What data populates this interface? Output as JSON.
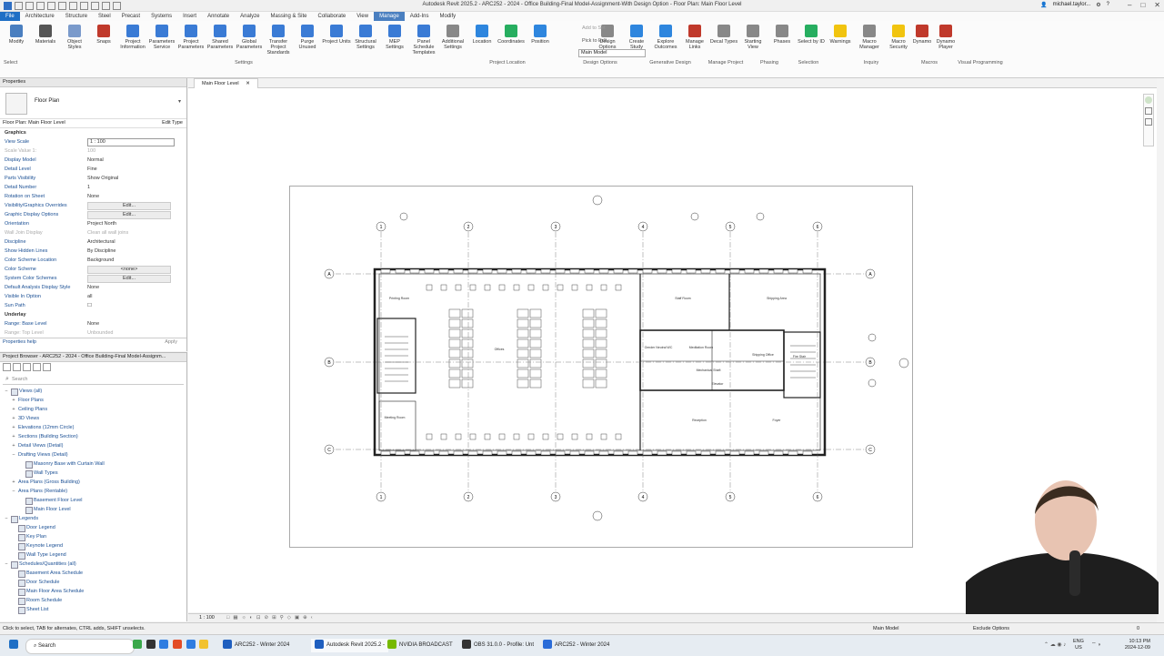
{
  "titlebar": {
    "title": "Autodesk Revit 2025.2 - ARC252 - 2024 - Office Building-Final Model-Assignment-With Design Option - Floor Plan: Main Floor Level",
    "user": "michael.taylor..."
  },
  "ribbon_tabs": [
    "File",
    "Architecture",
    "Structure",
    "Steel",
    "Precast",
    "Systems",
    "Insert",
    "Annotate",
    "Analyze",
    "Massing & Site",
    "Collaborate",
    "View",
    "Manage",
    "Add-Ins",
    "Modify"
  ],
  "ribbon_active_tab": "Manage",
  "ribbon": {
    "buttons": [
      {
        "label": "Modify",
        "color": "#4a7fc0"
      },
      {
        "label": "Materials",
        "color": "#555555"
      },
      {
        "label": "Object Styles",
        "color": "#7a9acb"
      },
      {
        "label": "Snaps",
        "color": "#c0392b"
      },
      {
        "label": "Project Information",
        "color": "#3a7bd5"
      },
      {
        "label": "Parameters Service",
        "color": "#3a7bd5"
      },
      {
        "label": "Project Parameters",
        "color": "#3a7bd5"
      },
      {
        "label": "Shared Parameters",
        "color": "#3a7bd5"
      },
      {
        "label": "Global Parameters",
        "color": "#3a7bd5"
      },
      {
        "label": "Transfer Project Standards",
        "color": "#3a7bd5"
      },
      {
        "label": "Purge Unused",
        "color": "#3a7bd5"
      },
      {
        "label": "Project Units",
        "color": "#3a7bd5"
      },
      {
        "label": "Structural Settings",
        "color": "#3a7bd5"
      },
      {
        "label": "MEP Settings",
        "color": "#3a7bd5"
      },
      {
        "label": "Panel Schedule Templates",
        "color": "#3a7bd5"
      },
      {
        "label": "Additional Settings",
        "color": "#888888"
      },
      {
        "label": "Location",
        "color": "#2e86de"
      },
      {
        "label": "Coordinates",
        "color": "#27ae60"
      },
      {
        "label": "Position",
        "color": "#2e86de"
      },
      {
        "label": "Design Options",
        "color": "#888888"
      },
      {
        "label": "Create Study",
        "color": "#2e86de"
      },
      {
        "label": "Explore Outcomes",
        "color": "#2e86de"
      },
      {
        "label": "Manage Links",
        "color": "#c0392b"
      },
      {
        "label": "Decal Types",
        "color": "#888888"
      },
      {
        "label": "Starting View",
        "color": "#888888"
      },
      {
        "label": "Phases",
        "color": "#888888"
      },
      {
        "label": "Select by ID",
        "color": "#27ae60"
      },
      {
        "label": "Warnings",
        "color": "#f1c40f"
      },
      {
        "label": "Macro Manager",
        "color": "#888888"
      },
      {
        "label": "Macro Security",
        "color": "#f1c40f"
      },
      {
        "label": "Dynamo",
        "color": "#c0392b"
      },
      {
        "label": "Dynamo Player",
        "color": "#c0392b"
      }
    ],
    "design_option_field": "Main Model",
    "add_to_set": "Add to Set",
    "pick_to_edit": "Pick to Edit",
    "groups": [
      "Settings",
      "Project Location",
      "Design Options",
      "Generative Design",
      "Manage Project",
      "Phasing",
      "Selection",
      "Inquiry",
      "Macros",
      "Visual Programming"
    ],
    "select_label": "Select"
  },
  "properties": {
    "header": "Properties",
    "type_name": "Floor Plan",
    "selector": "Floor Plan: Main Floor Level",
    "edit_type": "Edit Type",
    "rows": [
      {
        "k": "Graphics",
        "v": "",
        "cat": true
      },
      {
        "k": "View Scale",
        "v": "1 : 100",
        "input": true
      },
      {
        "k": "Scale Value    1:",
        "v": "100",
        "disabled": true
      },
      {
        "k": "Display Model",
        "v": "Normal"
      },
      {
        "k": "Detail Level",
        "v": "Fine"
      },
      {
        "k": "Parts Visibility",
        "v": "Show Original"
      },
      {
        "k": "Detail Number",
        "v": "1"
      },
      {
        "k": "Rotation on Sheet",
        "v": "None"
      },
      {
        "k": "Visibility/Graphics Overrides",
        "v": "Edit...",
        "btn": true
      },
      {
        "k": "Graphic Display Options",
        "v": "Edit...",
        "btn": true
      },
      {
        "k": "Orientation",
        "v": "Project North"
      },
      {
        "k": "Wall Join Display",
        "v": "Clean all wall joins",
        "disabled": true
      },
      {
        "k": "Discipline",
        "v": "Architectural"
      },
      {
        "k": "Show Hidden Lines",
        "v": "By Discipline"
      },
      {
        "k": "Color Scheme Location",
        "v": "Background"
      },
      {
        "k": "Color Scheme",
        "v": "<none>",
        "btn": true
      },
      {
        "k": "System Color Schemes",
        "v": "Edit...",
        "btn": true
      },
      {
        "k": "Default Analysis Display Style",
        "v": "None"
      },
      {
        "k": "Sun Path",
        "v": "☐"
      },
      {
        "k": "Underlay",
        "v": "",
        "cat": true
      },
      {
        "k": "Range: Base Level",
        "v": "None"
      },
      {
        "k": "Range: Top Level",
        "v": "Unbounded",
        "disabled": true
      }
    ],
    "visible_in_option": {
      "k": "Visible In Option",
      "v": "all"
    },
    "help_link": "Properties help",
    "apply": "Apply"
  },
  "browser": {
    "header": "Project Browser - ARC252 - 2024 - Office Building-Final Model-Assignm...",
    "search_placeholder": "Search",
    "tree": [
      {
        "t": "Views (all)",
        "lvl": 0,
        "exp": "−",
        "sq": true
      },
      {
        "t": "Floor Plans",
        "lvl": 1,
        "exp": "+"
      },
      {
        "t": "Ceiling Plans",
        "lvl": 1,
        "exp": "+"
      },
      {
        "t": "3D Views",
        "lvl": 1,
        "exp": "+"
      },
      {
        "t": "Elevations (12mm Circle)",
        "lvl": 1,
        "exp": "+"
      },
      {
        "t": "Sections (Building Section)",
        "lvl": 1,
        "exp": "+"
      },
      {
        "t": "Detail Views (Detail)",
        "lvl": 1,
        "exp": "+"
      },
      {
        "t": "Drafting Views (Detail)",
        "lvl": 1,
        "exp": "−"
      },
      {
        "t": "Masonry Base with Curtain Wall",
        "lvl": 2,
        "sq": true
      },
      {
        "t": "Wall Types",
        "lvl": 2,
        "sq": true
      },
      {
        "t": "Area Plans (Gross Building)",
        "lvl": 1,
        "exp": "+"
      },
      {
        "t": "Area Plans (Rentable)",
        "lvl": 1,
        "exp": "−"
      },
      {
        "t": "Basement Floor Level",
        "lvl": 2,
        "sq": true
      },
      {
        "t": "Main Floor Level",
        "lvl": 2,
        "sq": true
      },
      {
        "t": "Legends",
        "lvl": 0,
        "exp": "−",
        "sq": true
      },
      {
        "t": "Door Legend",
        "lvl": 1,
        "sq": true
      },
      {
        "t": "Key Plan",
        "lvl": 1,
        "sq": true
      },
      {
        "t": "Keynote Legend",
        "lvl": 1,
        "sq": true
      },
      {
        "t": "Wall Type Legend",
        "lvl": 1,
        "sq": true
      },
      {
        "t": "Schedules/Quantities (all)",
        "lvl": 0,
        "exp": "−",
        "sq": true
      },
      {
        "t": "Basement Area Schedule",
        "lvl": 1,
        "sq": true
      },
      {
        "t": "Door Schedule",
        "lvl": 1,
        "sq": true
      },
      {
        "t": "Main Floor Area Schedule",
        "lvl": 1,
        "sq": true
      },
      {
        "t": "Room Schedule",
        "lvl": 1,
        "sq": true
      },
      {
        "t": "Sheet List",
        "lvl": 1,
        "sq": true
      }
    ]
  },
  "view": {
    "tab_label": "Main Floor Level",
    "scale": "1 : 100",
    "grid_cols": [
      "1",
      "2",
      "3",
      "4",
      "5",
      "6"
    ],
    "grid_rows": [
      "A",
      "B",
      "C"
    ],
    "rooms": [
      "Printing Room",
      "Offices",
      "Meeting Room",
      "Staff Room",
      "Shipping Area",
      "Gender Neutral WC",
      "Mechanical Shaft",
      "Meditation Room",
      "Shipping Office",
      "Fire Stair",
      "Reception",
      "Foyer",
      "Elevator"
    ]
  },
  "status": {
    "hint": "Click to select, TAB for alternates, CTRL adds, SHIFT unselects.",
    "model": "Main Model",
    "exclude": "Exclude Options",
    "filter_count": "0"
  },
  "taskbar": {
    "search": "Search",
    "items": [
      {
        "label": "ARC252 - Winter 2024",
        "color": "#1f5fbf"
      },
      {
        "label": "Autodesk Revit 2025.2 -",
        "color": "#1f5fbf"
      },
      {
        "label": "NVIDIA BROADCAST",
        "color": "#76b900"
      },
      {
        "label": "OBS 31.0.0 - Profile: Unt",
        "color": "#333333"
      },
      {
        "label": "ARC252 - Winter 2024",
        "color": "#2b6cd8"
      }
    ],
    "lang": "ENG",
    "region": "US",
    "time": "10:13 PM",
    "date": "2024-12-09"
  }
}
